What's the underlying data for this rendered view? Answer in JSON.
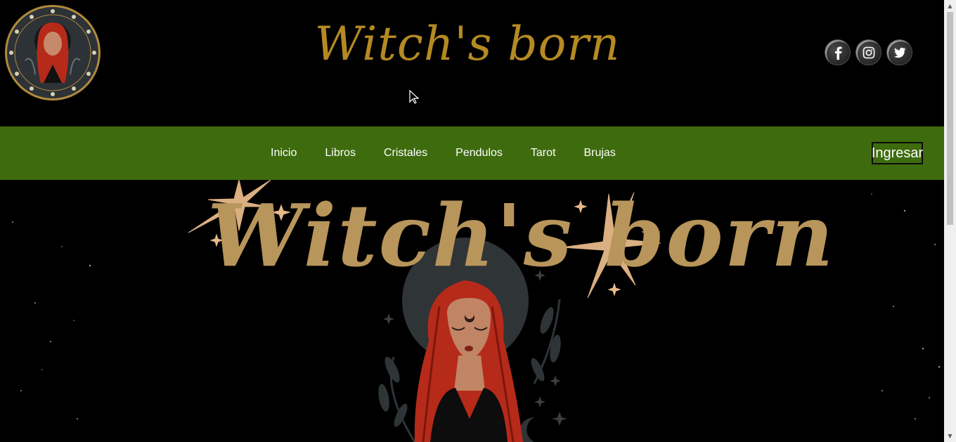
{
  "header": {
    "title": "Witch's born",
    "logo_icon": "witch-medallion-logo",
    "socials": [
      {
        "name": "facebook",
        "icon": "facebook-icon"
      },
      {
        "name": "instagram",
        "icon": "instagram-icon"
      },
      {
        "name": "twitter",
        "icon": "twitter-icon"
      }
    ]
  },
  "nav": {
    "items": [
      {
        "label": "Inicio"
      },
      {
        "label": "Libros"
      },
      {
        "label": "Cristales"
      },
      {
        "label": "Pendulos"
      },
      {
        "label": "Tarot"
      },
      {
        "label": "Brujas"
      }
    ],
    "login_label": "Ingresar"
  },
  "hero": {
    "title": "Witch's born",
    "image_icon": "witch-illustration"
  },
  "colors": {
    "background": "#000000",
    "title_gold": "#b58a22",
    "nav_green": "#3e6b0e",
    "hero_gold": "#b8955a",
    "hair_red": "#b62a1a"
  }
}
